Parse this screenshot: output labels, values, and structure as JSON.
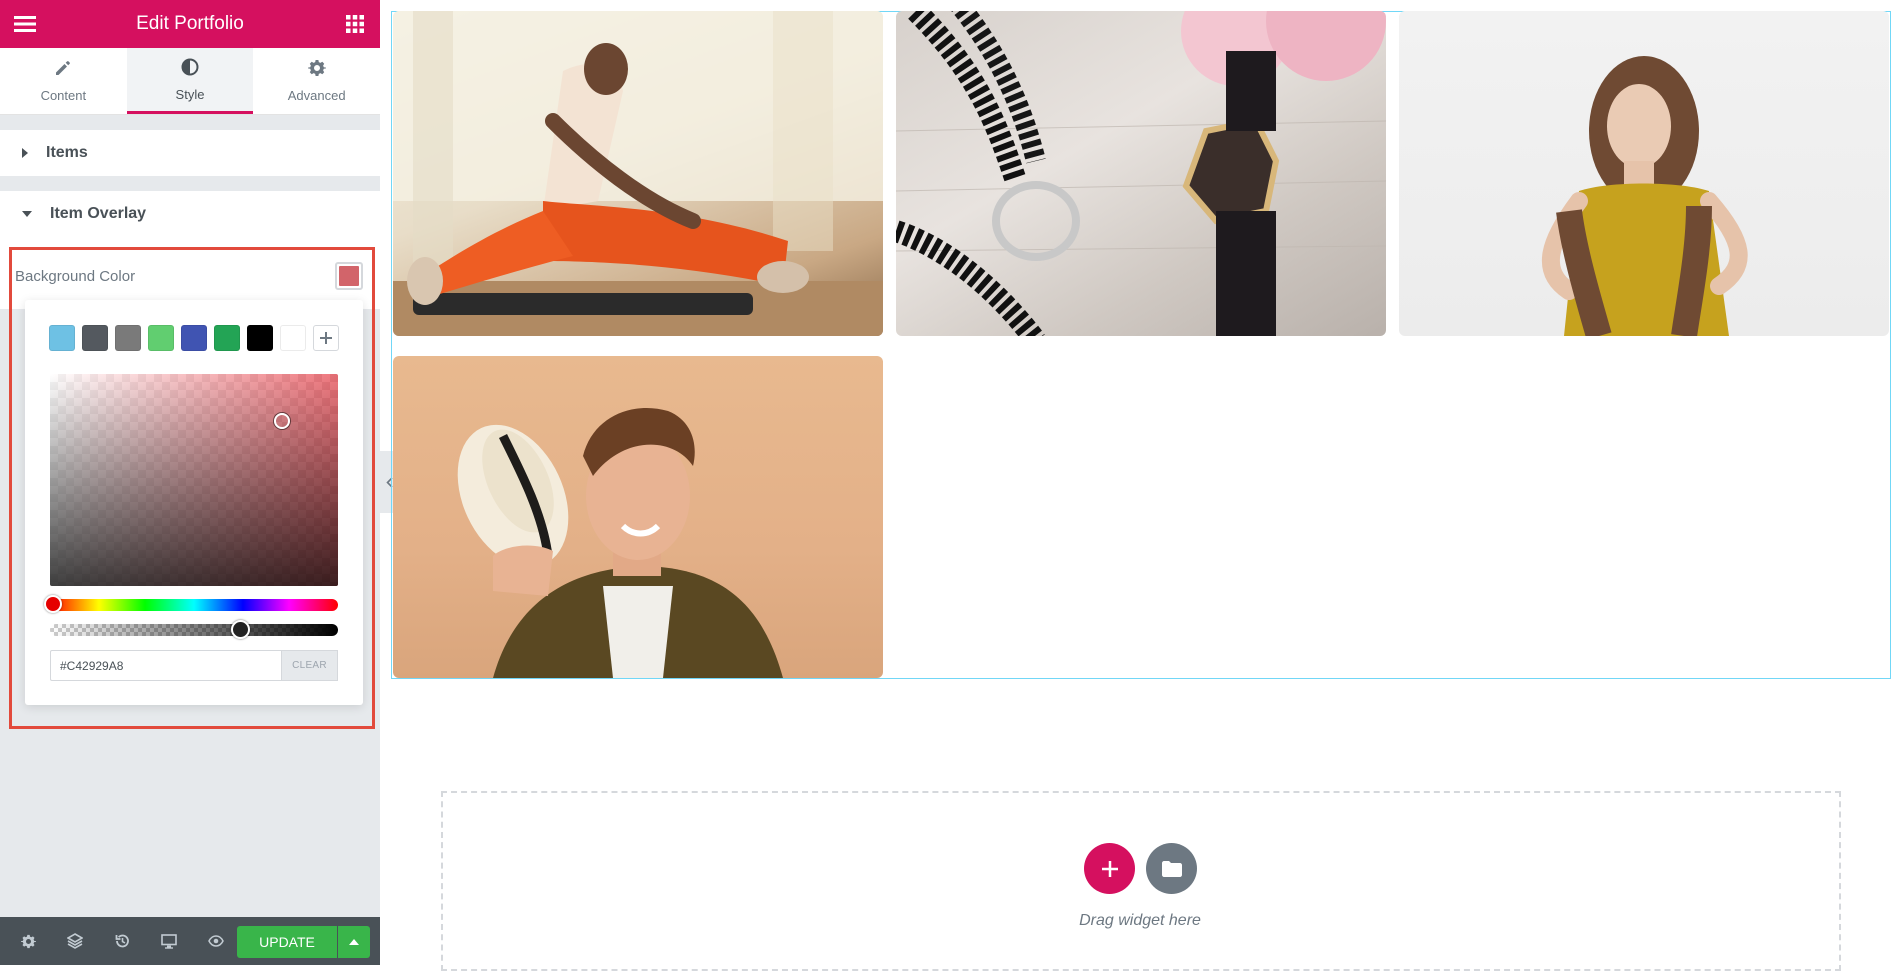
{
  "header": {
    "title": "Edit Portfolio"
  },
  "tabs": [
    {
      "label": "Content",
      "icon": "pencil-icon"
    },
    {
      "label": "Style",
      "icon": "half-circle-icon",
      "active": true
    },
    {
      "label": "Advanced",
      "icon": "gear-icon"
    }
  ],
  "sections": {
    "items": "Items",
    "item_overlay": "Item Overlay"
  },
  "control": {
    "label": "Background Color",
    "value": "#C42929A8",
    "clear_label": "CLEAR",
    "preset_colors": [
      "#6ec1e4",
      "#54595f",
      "#7a7a7a",
      "#61ce70",
      "#4054b2",
      "#23a455",
      "#000000",
      "#ffffff"
    ]
  },
  "footer": {
    "update_label": "UPDATE"
  },
  "canvas": {
    "drag_text": "Drag widget here"
  },
  "colors": {
    "accent": "#d5105f",
    "update": "#39b54a",
    "panel_bg": "#e6e9ec",
    "highlight": "#e24a3c"
  }
}
